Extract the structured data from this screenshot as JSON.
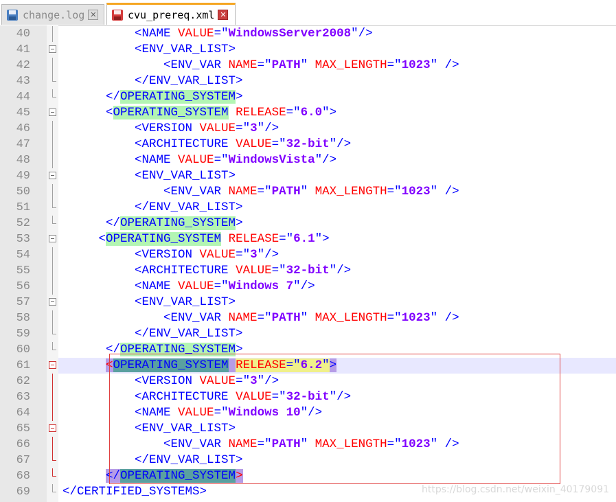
{
  "tabs": [
    {
      "label": "change.log",
      "icon": "save-disk-icon",
      "state": "inactive"
    },
    {
      "label": "cvu_prereq.xml",
      "icon": "save-disk-icon",
      "state": "active"
    }
  ],
  "colors": {
    "tag": "#0000ff",
    "attribute": "#ff0000",
    "value": "#8000ff",
    "match_highlight": "#b3f5b3",
    "selection_box": "#e04040",
    "current_line": "#e8e8ff"
  },
  "current_line": "61",
  "lines": [
    {
      "n": "40",
      "indent": "          ",
      "p": [
        {
          "t": "<NAME ",
          "c": "b"
        },
        {
          "t": "VALUE",
          "c": "a"
        },
        {
          "t": "=\"",
          "c": "b"
        },
        {
          "t": "WindowsServer2008",
          "c": "v"
        },
        {
          "t": "\"/>",
          "c": "b"
        }
      ],
      "fold": "line"
    },
    {
      "n": "41",
      "indent": "          ",
      "p": [
        {
          "t": "<ENV_VAR_LIST>",
          "c": "b"
        }
      ],
      "fold": "box"
    },
    {
      "n": "42",
      "indent": "              ",
      "p": [
        {
          "t": "<ENV_VAR ",
          "c": "b"
        },
        {
          "t": "NAME",
          "c": "a"
        },
        {
          "t": "=\"",
          "c": "b"
        },
        {
          "t": "PATH",
          "c": "v"
        },
        {
          "t": "\" ",
          "c": "b"
        },
        {
          "t": "MAX_LENGTH",
          "c": "a"
        },
        {
          "t": "=\"",
          "c": "b"
        },
        {
          "t": "1023",
          "c": "v"
        },
        {
          "t": "\" />",
          "c": "b"
        }
      ],
      "fold": "line"
    },
    {
      "n": "43",
      "indent": "          ",
      "p": [
        {
          "t": "</ENV_VAR_LIST>",
          "c": "b"
        }
      ],
      "fold": "end"
    },
    {
      "n": "44",
      "indent": "      ",
      "p": [
        {
          "t": "</",
          "c": "b"
        },
        {
          "t": "OPERATING_SYSTEM",
          "c": "b",
          "h": "hl-g"
        },
        {
          "t": ">",
          "c": "b"
        }
      ],
      "fold": "end"
    },
    {
      "n": "45",
      "indent": "      ",
      "p": [
        {
          "t": "<",
          "c": "b"
        },
        {
          "t": "OPERATING_SYSTEM",
          "c": "b",
          "h": "hl-g"
        },
        {
          "t": " ",
          "c": "b"
        },
        {
          "t": "RELEASE",
          "c": "a"
        },
        {
          "t": "=\"",
          "c": "b"
        },
        {
          "t": "6.0",
          "c": "v"
        },
        {
          "t": "\">",
          "c": "b"
        }
      ],
      "fold": "box"
    },
    {
      "n": "46",
      "indent": "          ",
      "p": [
        {
          "t": "<VERSION ",
          "c": "b"
        },
        {
          "t": "VALUE",
          "c": "a"
        },
        {
          "t": "=\"",
          "c": "b"
        },
        {
          "t": "3",
          "c": "v"
        },
        {
          "t": "\"/>",
          "c": "b"
        }
      ],
      "fold": "line"
    },
    {
      "n": "47",
      "indent": "          ",
      "p": [
        {
          "t": "<ARCHITECTURE ",
          "c": "b"
        },
        {
          "t": "VALUE",
          "c": "a"
        },
        {
          "t": "=\"",
          "c": "b"
        },
        {
          "t": "32-bit",
          "c": "v"
        },
        {
          "t": "\"/>",
          "c": "b"
        }
      ],
      "fold": "line"
    },
    {
      "n": "48",
      "indent": "          ",
      "p": [
        {
          "t": "<NAME ",
          "c": "b"
        },
        {
          "t": "VALUE",
          "c": "a"
        },
        {
          "t": "=\"",
          "c": "b"
        },
        {
          "t": "WindowsVista",
          "c": "v"
        },
        {
          "t": "\"/>",
          "c": "b"
        }
      ],
      "fold": "line"
    },
    {
      "n": "49",
      "indent": "          ",
      "p": [
        {
          "t": "<ENV_VAR_LIST>",
          "c": "b"
        }
      ],
      "fold": "box"
    },
    {
      "n": "50",
      "indent": "              ",
      "p": [
        {
          "t": "<ENV_VAR ",
          "c": "b"
        },
        {
          "t": "NAME",
          "c": "a"
        },
        {
          "t": "=\"",
          "c": "b"
        },
        {
          "t": "PATH",
          "c": "v"
        },
        {
          "t": "\" ",
          "c": "b"
        },
        {
          "t": "MAX_LENGTH",
          "c": "a"
        },
        {
          "t": "=\"",
          "c": "b"
        },
        {
          "t": "1023",
          "c": "v"
        },
        {
          "t": "\" />",
          "c": "b"
        }
      ],
      "fold": "line"
    },
    {
      "n": "51",
      "indent": "          ",
      "p": [
        {
          "t": "</ENV_VAR_LIST>",
          "c": "b"
        }
      ],
      "fold": "end"
    },
    {
      "n": "52",
      "indent": "      ",
      "p": [
        {
          "t": "</",
          "c": "b"
        },
        {
          "t": "OPERATING_SYSTEM",
          "c": "b",
          "h": "hl-g"
        },
        {
          "t": ">",
          "c": "b"
        }
      ],
      "fold": "end"
    },
    {
      "n": "53",
      "indent": "     ",
      "p": [
        {
          "t": "<",
          "c": "b"
        },
        {
          "t": "OPERATING_SYSTEM",
          "c": "b",
          "h": "hl-g"
        },
        {
          "t": " ",
          "c": "b"
        },
        {
          "t": "RELEASE",
          "c": "a"
        },
        {
          "t": "=\"",
          "c": "b"
        },
        {
          "t": "6.1",
          "c": "v"
        },
        {
          "t": "\">",
          "c": "b"
        }
      ],
      "fold": "box"
    },
    {
      "n": "54",
      "indent": "          ",
      "p": [
        {
          "t": "<VERSION ",
          "c": "b"
        },
        {
          "t": "VALUE",
          "c": "a"
        },
        {
          "t": "=\"",
          "c": "b"
        },
        {
          "t": "3",
          "c": "v"
        },
        {
          "t": "\"/>",
          "c": "b"
        }
      ],
      "fold": "line"
    },
    {
      "n": "55",
      "indent": "          ",
      "p": [
        {
          "t": "<ARCHITECTURE ",
          "c": "b"
        },
        {
          "t": "VALUE",
          "c": "a"
        },
        {
          "t": "=\"",
          "c": "b"
        },
        {
          "t": "32-bit",
          "c": "v"
        },
        {
          "t": "\"/>",
          "c": "b"
        }
      ],
      "fold": "line"
    },
    {
      "n": "56",
      "indent": "          ",
      "p": [
        {
          "t": "<NAME ",
          "c": "b"
        },
        {
          "t": "VALUE",
          "c": "a"
        },
        {
          "t": "=\"",
          "c": "b"
        },
        {
          "t": "Windows 7",
          "c": "v"
        },
        {
          "t": "\"/>",
          "c": "b"
        }
      ],
      "fold": "line"
    },
    {
      "n": "57",
      "indent": "          ",
      "p": [
        {
          "t": "<ENV_VAR_LIST>",
          "c": "b"
        }
      ],
      "fold": "box"
    },
    {
      "n": "58",
      "indent": "              ",
      "p": [
        {
          "t": "<ENV_VAR ",
          "c": "b"
        },
        {
          "t": "NAME",
          "c": "a"
        },
        {
          "t": "=\"",
          "c": "b"
        },
        {
          "t": "PATH",
          "c": "v"
        },
        {
          "t": "\" ",
          "c": "b"
        },
        {
          "t": "MAX_LENGTH",
          "c": "a"
        },
        {
          "t": "=\"",
          "c": "b"
        },
        {
          "t": "1023",
          "c": "v"
        },
        {
          "t": "\" />",
          "c": "b"
        }
      ],
      "fold": "line"
    },
    {
      "n": "59",
      "indent": "          ",
      "p": [
        {
          "t": "</ENV_VAR_LIST>",
          "c": "b"
        }
      ],
      "fold": "end"
    },
    {
      "n": "60",
      "indent": "      ",
      "p": [
        {
          "t": "</",
          "c": "b"
        },
        {
          "t": "OPERATING_SYSTEM",
          "c": "b",
          "h": "hl-g"
        },
        {
          "t": ">",
          "c": "b"
        }
      ],
      "fold": "end"
    },
    {
      "n": "61",
      "indent": "      ",
      "p": [
        {
          "t": "<",
          "c": "a",
          "h": "hl-purple"
        },
        {
          "t": "OPERATING_SYSTEM",
          "c": "b",
          "h": "hl-blue"
        },
        {
          "t": " ",
          "c": "b",
          "h": "hl-purple"
        },
        {
          "t": "RELEASE",
          "c": "a",
          "h": "hl-yellow"
        },
        {
          "t": "=\"",
          "c": "b",
          "h": "hl-yellow"
        },
        {
          "t": "6.2",
          "c": "v",
          "h": "hl-yellow"
        },
        {
          "t": "\"",
          "c": "b",
          "h": "hl-yellow"
        },
        {
          "t": ">",
          "c": "b",
          "h": "hl-purple"
        }
      ],
      "fold": "boxred"
    },
    {
      "n": "62",
      "indent": "          ",
      "p": [
        {
          "t": "<VERSION ",
          "c": "b"
        },
        {
          "t": "VALUE",
          "c": "a"
        },
        {
          "t": "=\"",
          "c": "b"
        },
        {
          "t": "3",
          "c": "v"
        },
        {
          "t": "\"/>",
          "c": "b"
        }
      ],
      "fold": "linered"
    },
    {
      "n": "63",
      "indent": "          ",
      "p": [
        {
          "t": "<ARCHITECTURE ",
          "c": "b"
        },
        {
          "t": "VALUE",
          "c": "a"
        },
        {
          "t": "=\"",
          "c": "b"
        },
        {
          "t": "32-bit",
          "c": "v"
        },
        {
          "t": "\"/>",
          "c": "b"
        }
      ],
      "fold": "linered"
    },
    {
      "n": "64",
      "indent": "          ",
      "p": [
        {
          "t": "<NAME ",
          "c": "b"
        },
        {
          "t": "VALUE",
          "c": "a"
        },
        {
          "t": "=\"",
          "c": "b"
        },
        {
          "t": "Windows 10",
          "c": "v"
        },
        {
          "t": "\"/>",
          "c": "b"
        }
      ],
      "fold": "linered"
    },
    {
      "n": "65",
      "indent": "          ",
      "p": [
        {
          "t": "<ENV_VAR_LIST>",
          "c": "b"
        }
      ],
      "fold": "boxred"
    },
    {
      "n": "66",
      "indent": "              ",
      "p": [
        {
          "t": "<ENV_VAR ",
          "c": "b"
        },
        {
          "t": "NAME",
          "c": "a"
        },
        {
          "t": "=\"",
          "c": "b"
        },
        {
          "t": "PATH",
          "c": "v"
        },
        {
          "t": "\" ",
          "c": "b"
        },
        {
          "t": "MAX_LENGTH",
          "c": "a"
        },
        {
          "t": "=\"",
          "c": "b"
        },
        {
          "t": "1023",
          "c": "v"
        },
        {
          "t": "\" />",
          "c": "b"
        }
      ],
      "fold": "linered"
    },
    {
      "n": "67",
      "indent": "          ",
      "p": [
        {
          "t": "</ENV_VAR_LIST>",
          "c": "b"
        }
      ],
      "fold": "endred"
    },
    {
      "n": "68",
      "indent": "      ",
      "p": [
        {
          "t": "</",
          "c": "b",
          "h": "hl-purple"
        },
        {
          "t": "OPERATING_SYSTEM",
          "c": "b",
          "h": "hl-blue"
        },
        {
          "t": ">",
          "c": "a",
          "h": "hl-purple"
        }
      ],
      "fold": "endred"
    },
    {
      "n": "69",
      "indent": "",
      "p": [
        {
          "t": "</CERTIFIED_SYSTEMS>",
          "c": "b"
        }
      ],
      "fold": "end"
    }
  ],
  "watermark": "https://blog.csdn.net/weixin_40179091"
}
